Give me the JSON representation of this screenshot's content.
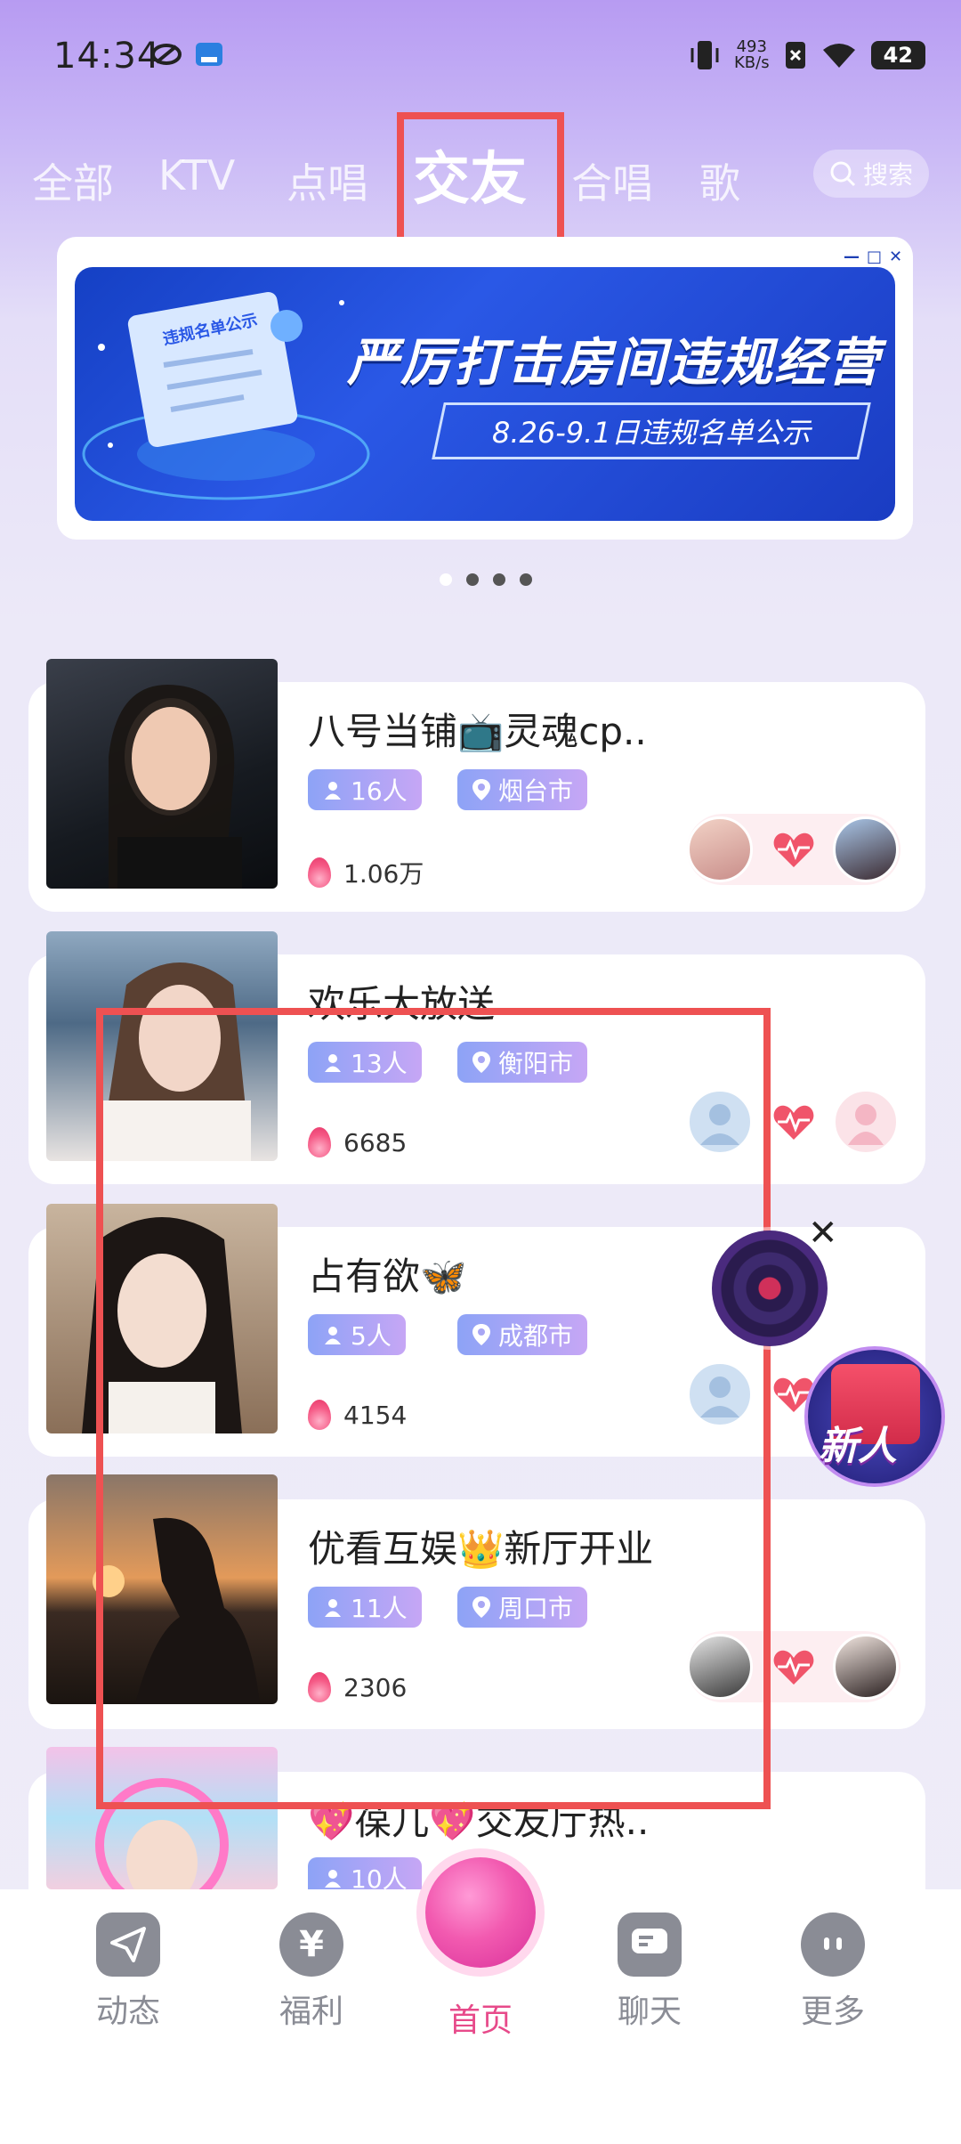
{
  "status": {
    "time": "14:34",
    "net_speed_value": "493",
    "net_speed_unit": "KB/s",
    "battery": "42"
  },
  "tabs": [
    {
      "label": "全部"
    },
    {
      "label": "KTV"
    },
    {
      "label": "点唱"
    },
    {
      "label": "交友",
      "active": true
    },
    {
      "label": "合唱"
    },
    {
      "label": "歌"
    }
  ],
  "search": {
    "label": "搜索"
  },
  "banner": {
    "title": "严厉打击房间违规经营",
    "subtitle": "8.26-9.1日违规名单公示",
    "doc_label": "违规名单公示"
  },
  "carousel": {
    "count": 4,
    "active_index": 0
  },
  "rooms": [
    {
      "title": "八号当铺📺灵魂cp..",
      "members": "16人",
      "city": "烟台市",
      "heat": "1.06万"
    },
    {
      "title": "欢乐大放送",
      "members": "13人",
      "city": "衡阳市",
      "heat": "6685"
    },
    {
      "title": "占有欲🦋",
      "members": "5人",
      "city": "成都市",
      "heat": "4154"
    },
    {
      "title": "优看互娱👑新厅开业",
      "members": "11人",
      "city": "周口市",
      "heat": "2306"
    },
    {
      "title": "💖葆儿💖交友厅热..",
      "members": "10人",
      "city": "",
      "heat": ""
    }
  ],
  "floating": {
    "gift_label": "新人",
    "close_symbol": "✕"
  },
  "bottom_nav": [
    {
      "label": "动态",
      "icon": "paper-plane-icon"
    },
    {
      "label": "福利",
      "icon": "yen-icon"
    },
    {
      "label": "首页",
      "icon": "home-ball-icon",
      "active": true
    },
    {
      "label": "聊天",
      "icon": "chat-icon"
    },
    {
      "label": "更多",
      "icon": "more-face-icon"
    }
  ],
  "colors": {
    "accent_pink": "#e74a8a",
    "highlight_red": "#ee5152",
    "banner_blue": "#2a58e6"
  }
}
